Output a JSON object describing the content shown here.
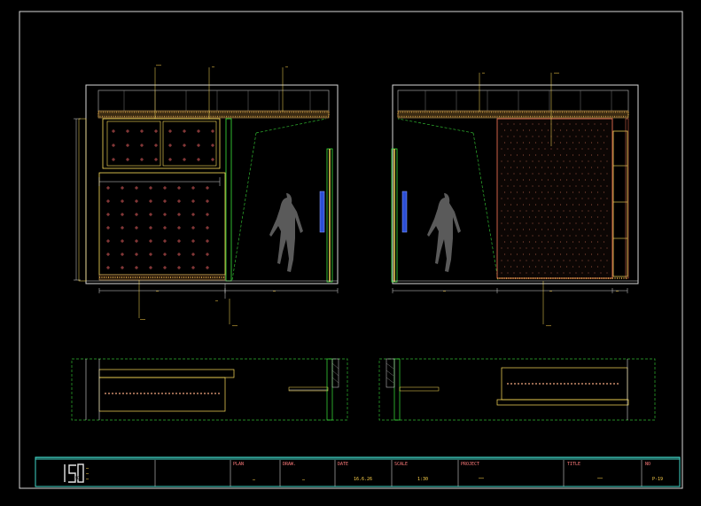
{
  "drawing": {
    "background": "#000000",
    "line_colors": {
      "frame": "#d8d8d8",
      "accent_green": "#3ce83c",
      "accent_yellow": "#ffe05a",
      "hatch_red": "#ff5a5a",
      "dashed_green": "#2fb52f",
      "title_frame": "#41d6c8"
    },
    "elevation_left": {
      "callouts": [
        "……",
        "…",
        "…"
      ],
      "dims_bottom": [
        "…",
        "…",
        "…"
      ],
      "note_bottom": "……",
      "note_bottom2": "……"
    },
    "elevation_right": {
      "callouts": [
        "…",
        "……"
      ],
      "dims_bottom": [
        "…",
        "…",
        "…"
      ],
      "note_bottom": "……"
    }
  },
  "title_block": {
    "logo_text": "ISD",
    "company_line1": "…",
    "company_line2": "…",
    "company_line3": "…",
    "plan_label": "PLAN",
    "plan_value": "…",
    "draw_label": "DRAW.",
    "draw_value": "…",
    "date_label": "DATE",
    "date_value": "16.6.26",
    "scale_label": "SCALE",
    "scale_value": "1:30",
    "project_label": "PROJECT",
    "project_value": "……",
    "title_label": "TITLE",
    "title_value": "……",
    "no_label": "NO",
    "no_value": "P-19"
  }
}
